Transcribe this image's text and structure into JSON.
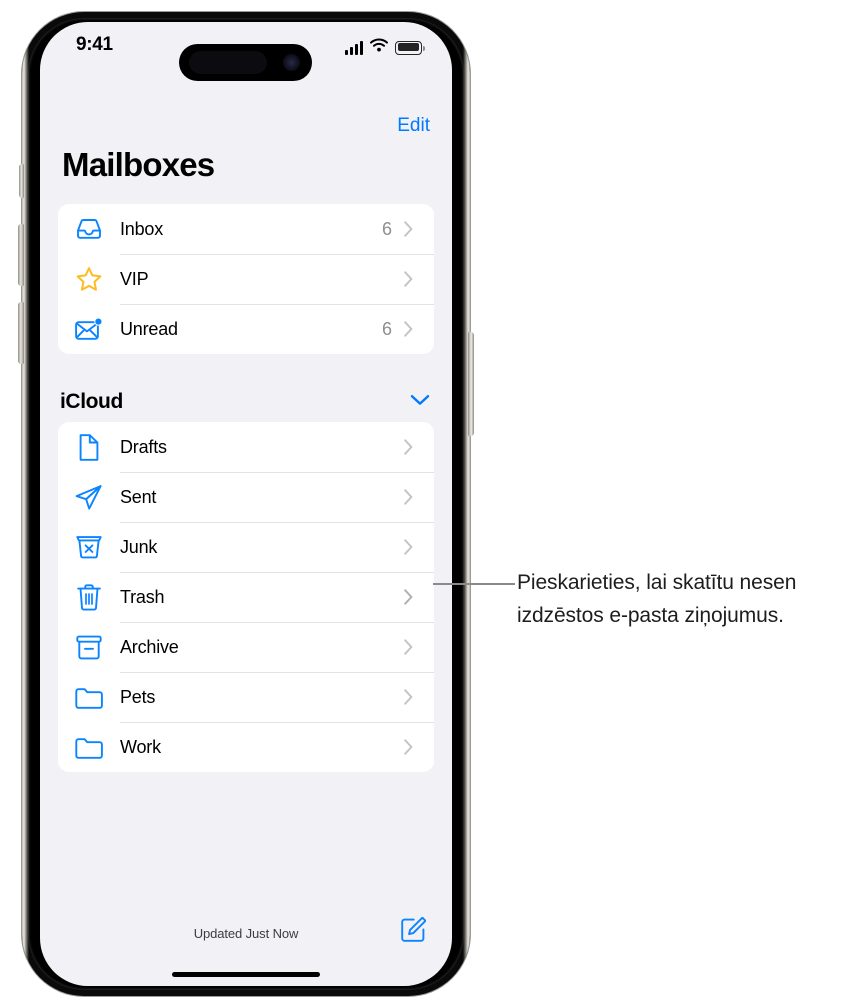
{
  "status_bar": {
    "time": "9:41",
    "signal_icon": "cellular-signal-icon",
    "wifi_icon": "wifi-icon",
    "battery_icon": "battery-icon"
  },
  "nav": {
    "edit_label": "Edit",
    "title": "Mailboxes"
  },
  "primary_mailboxes": [
    {
      "label": "Inbox",
      "count": "6",
      "icon": "inbox-tray-icon"
    },
    {
      "label": "VIP",
      "count": "",
      "icon": "star-icon"
    },
    {
      "label": "Unread",
      "count": "6",
      "icon": "unread-envelope-icon"
    }
  ],
  "account_section": {
    "title": "iCloud",
    "collapse_icon": "chevron-down-icon",
    "mailboxes": [
      {
        "label": "Drafts",
        "count": "",
        "icon": "document-icon"
      },
      {
        "label": "Sent",
        "count": "",
        "icon": "paper-plane-icon"
      },
      {
        "label": "Junk",
        "count": "",
        "icon": "junk-bin-icon"
      },
      {
        "label": "Trash",
        "count": "",
        "icon": "trash-icon"
      },
      {
        "label": "Archive",
        "count": "",
        "icon": "archive-box-icon"
      },
      {
        "label": "Pets",
        "count": "",
        "icon": "folder-icon"
      },
      {
        "label": "Work",
        "count": "",
        "icon": "folder-icon"
      }
    ]
  },
  "toolbar": {
    "updated_status": "Updated Just Now",
    "compose_icon": "compose-icon"
  },
  "callout": {
    "text": "Pieskarieties, lai skatītu nesen izdzēstos e-pasta ziņojumus."
  },
  "colors": {
    "accent_blue": "#007aff",
    "star_yellow": "#febb22",
    "screen_bg": "#f2f1f6",
    "card_bg": "#ffffff",
    "secondary_text": "#8e8e93"
  }
}
